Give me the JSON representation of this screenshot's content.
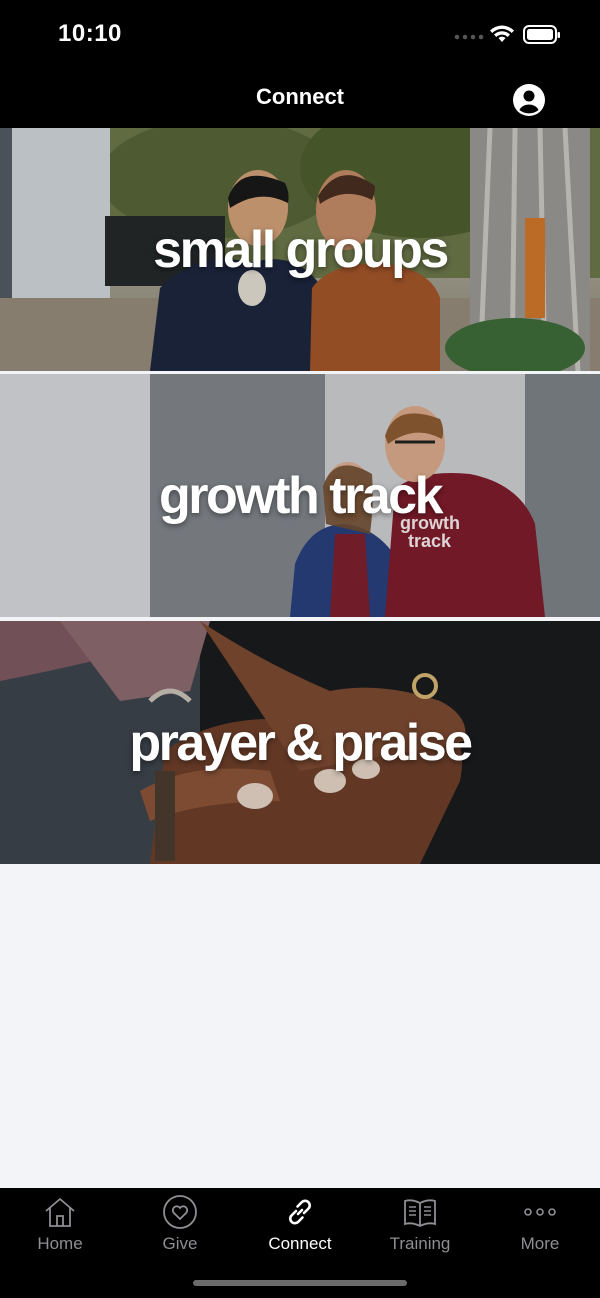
{
  "status_bar": {
    "time": "10:10"
  },
  "nav": {
    "title": "Connect"
  },
  "banners": [
    {
      "label": "small groups"
    },
    {
      "label": "growth track"
    },
    {
      "label": "prayer & praise"
    }
  ],
  "tabs": [
    {
      "label": "Home",
      "icon": "home-icon"
    },
    {
      "label": "Give",
      "icon": "heart-icon"
    },
    {
      "label": "Connect",
      "icon": "link-icon",
      "active": true
    },
    {
      "label": "Training",
      "icon": "book-icon"
    },
    {
      "label": "More",
      "icon": "more-icon"
    }
  ],
  "colors": {
    "background": "#f3f4f8",
    "bars": "#000000",
    "tab_inactive": "#8e8e93",
    "tab_active": "#ffffff"
  }
}
